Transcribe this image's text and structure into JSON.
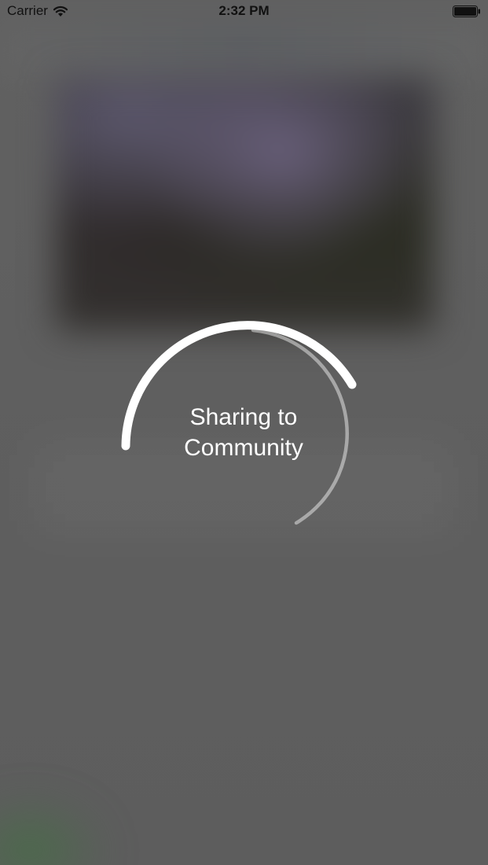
{
  "status_bar": {
    "carrier": "Carrier",
    "time": "2:32 PM",
    "wifi_icon": "wifi-icon",
    "battery_icon": "battery-icon"
  },
  "loader": {
    "line1": "Sharing to",
    "line2": "Community",
    "accent_color": "#ffffff"
  }
}
